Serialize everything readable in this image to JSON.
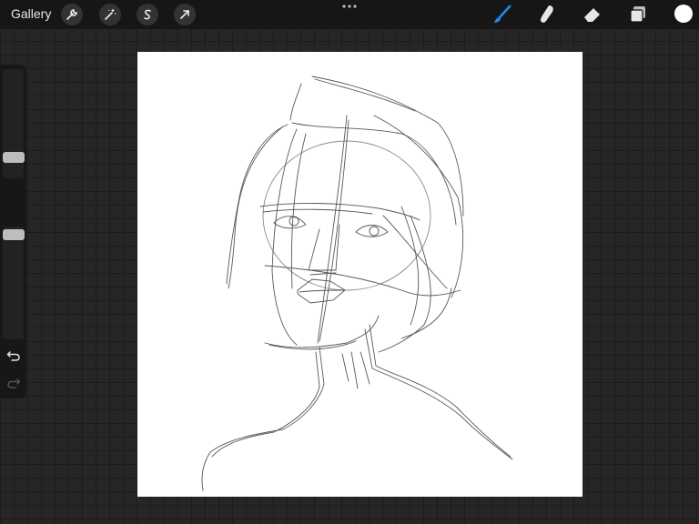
{
  "app": {
    "gallery_label": "Gallery"
  },
  "toolbar_left": {
    "items": [
      {
        "name": "actions",
        "icon": "wrench-icon"
      },
      {
        "name": "adjustments",
        "icon": "magic-wand-icon"
      },
      {
        "name": "selection",
        "icon": "selection-s-icon"
      },
      {
        "name": "transform",
        "icon": "arrow-cursor-icon"
      }
    ]
  },
  "toolbar_center": {
    "icon": "more-dots-icon"
  },
  "toolbar_right": {
    "items": [
      {
        "name": "brush",
        "icon": "brush-icon",
        "active": true
      },
      {
        "name": "smudge",
        "icon": "smudge-finger-icon"
      },
      {
        "name": "eraser",
        "icon": "eraser-icon"
      },
      {
        "name": "layers",
        "icon": "layers-icon"
      }
    ],
    "current_color": "#ffffff",
    "accent_color": "#1f8cf0"
  },
  "sidebar": {
    "brush_size_level": 0.42,
    "opacity_level": 0.4,
    "icons": [
      "modifier-square-icon",
      "undo-icon",
      "redo-icon"
    ]
  },
  "canvas": {
    "background": "#ffffff",
    "content": "pencil-sketch-portrait"
  }
}
